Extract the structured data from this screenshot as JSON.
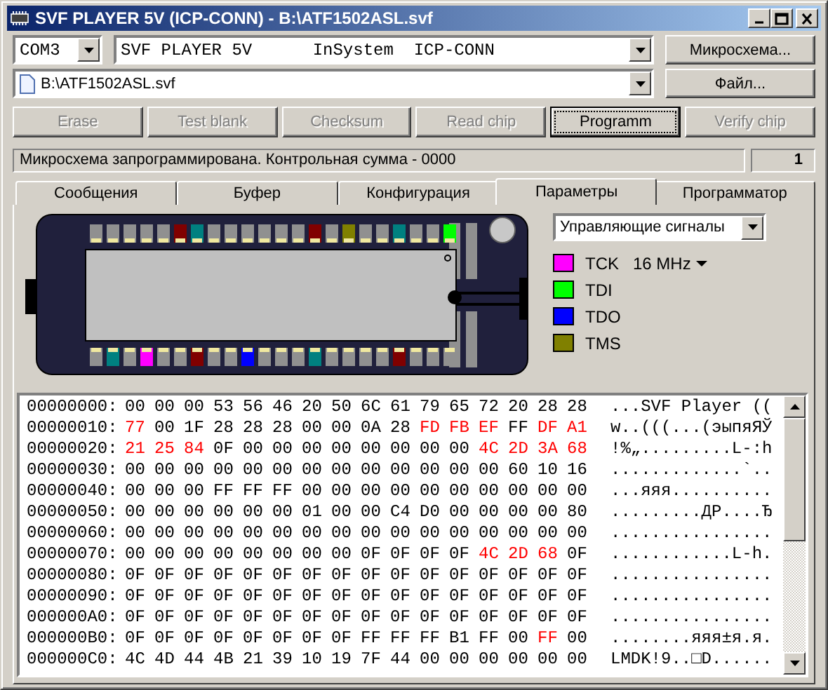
{
  "window": {
    "title": "SVF PLAYER 5V (ICP-CONN) - B:\\ATF1502ASL.svf"
  },
  "port_select": {
    "value": "COM3"
  },
  "device_select": {
    "value": "SVF PLAYER 5V      InSystem  ICP-CONN"
  },
  "chip_button": "Микросхема...",
  "file_select": {
    "value": "B:\\ATF1502ASL.svf"
  },
  "file_button": "Файл...",
  "actions": [
    {
      "label": "Erase",
      "disabled": true,
      "focused": false
    },
    {
      "label": "Test blank",
      "disabled": true,
      "focused": false
    },
    {
      "label": "Checksum",
      "disabled": true,
      "focused": false
    },
    {
      "label": "Read chip",
      "disabled": true,
      "focused": false
    },
    {
      "label": "Programm",
      "disabled": false,
      "focused": true
    },
    {
      "label": "Verify chip",
      "disabled": true,
      "focused": false
    }
  ],
  "status": {
    "message": "Микросхема запрограммирована. Контрольная сумма - 0000",
    "count": "1"
  },
  "tabs": [
    {
      "label": "Сообщения",
      "selected": false
    },
    {
      "label": "Буфер",
      "selected": false
    },
    {
      "label": "Конфигурация",
      "selected": false
    },
    {
      "label": "Параметры",
      "selected": true
    },
    {
      "label": "Программатор",
      "selected": false
    }
  ],
  "parameters": {
    "signal_select": {
      "value": "Управляющие сигналы"
    },
    "signals": [
      {
        "label": "TCK",
        "color": "#ff00ff",
        "frequency": "16 MHz"
      },
      {
        "label": "TDI",
        "color": "#00ff00"
      },
      {
        "label": "TDO",
        "color": "#0000ff"
      },
      {
        "label": "TMS",
        "color": "#808000"
      }
    ],
    "chip": {
      "top_pins": [
        {
          "color": "#909090"
        },
        {
          "color": "#909090"
        },
        {
          "color": "#909090"
        },
        {
          "color": "#909090"
        },
        {
          "color": "#909090"
        },
        {
          "color": "#800000"
        },
        {
          "color": "#008080"
        },
        {
          "color": "#909090"
        },
        {
          "color": "#909090"
        },
        {
          "color": "#909090"
        },
        {
          "color": "#909090"
        },
        {
          "color": "#909090"
        },
        {
          "color": "#909090"
        },
        {
          "color": "#800000"
        },
        {
          "color": "#909090"
        },
        {
          "color": "#808000"
        },
        {
          "color": "#909090"
        },
        {
          "color": "#909090"
        },
        {
          "color": "#008080"
        },
        {
          "color": "#909090"
        },
        {
          "color": "#909090"
        },
        {
          "color": "#00ff00"
        }
      ],
      "bottom_pins": [
        {
          "color": "#909090"
        },
        {
          "color": "#008080"
        },
        {
          "color": "#909090"
        },
        {
          "color": "#ff00ff"
        },
        {
          "color": "#909090"
        },
        {
          "color": "#909090"
        },
        {
          "color": "#800000"
        },
        {
          "color": "#909090"
        },
        {
          "color": "#909090"
        },
        {
          "color": "#0000ff"
        },
        {
          "color": "#909090"
        },
        {
          "color": "#909090"
        },
        {
          "color": "#909090"
        },
        {
          "color": "#008080"
        },
        {
          "color": "#909090"
        },
        {
          "color": "#909090"
        },
        {
          "color": "#909090"
        },
        {
          "color": "#909090"
        },
        {
          "color": "#800000"
        },
        {
          "color": "#909090"
        },
        {
          "color": "#909090"
        },
        {
          "color": "#909090"
        }
      ]
    }
  },
  "hex_dump": {
    "rows": [
      {
        "offset": "00000000:",
        "bytes": [
          {
            "value": "00",
            "changed": false
          },
          {
            "value": "00",
            "changed": false
          },
          {
            "value": "00",
            "changed": false
          },
          {
            "value": "53",
            "changed": false
          },
          {
            "value": "56",
            "changed": false
          },
          {
            "value": "46",
            "changed": false
          },
          {
            "value": "20",
            "changed": false
          },
          {
            "value": "50",
            "changed": false
          },
          {
            "value": "6C",
            "changed": false
          },
          {
            "value": "61",
            "changed": false
          },
          {
            "value": "79",
            "changed": false
          },
          {
            "value": "65",
            "changed": false
          },
          {
            "value": "72",
            "changed": false
          },
          {
            "value": "20",
            "changed": false
          },
          {
            "value": "28",
            "changed": false
          },
          {
            "value": "28",
            "changed": false
          }
        ],
        "ascii": "...SVF Player (("
      },
      {
        "offset": "00000010:",
        "bytes": [
          {
            "value": "77",
            "changed": true
          },
          {
            "value": "00",
            "changed": false
          },
          {
            "value": "1F",
            "changed": false
          },
          {
            "value": "28",
            "changed": false
          },
          {
            "value": "28",
            "changed": false
          },
          {
            "value": "28",
            "changed": false
          },
          {
            "value": "00",
            "changed": false
          },
          {
            "value": "00",
            "changed": false
          },
          {
            "value": "0A",
            "changed": false
          },
          {
            "value": "28",
            "changed": false
          },
          {
            "value": "FD",
            "changed": true
          },
          {
            "value": "FB",
            "changed": true
          },
          {
            "value": "EF",
            "changed": true
          },
          {
            "value": "FF",
            "changed": false
          },
          {
            "value": "DF",
            "changed": true
          },
          {
            "value": "A1",
            "changed": true
          }
        ],
        "ascii": "w..(((...(эыпяЯЎ"
      },
      {
        "offset": "00000020:",
        "bytes": [
          {
            "value": "21",
            "changed": true
          },
          {
            "value": "25",
            "changed": true
          },
          {
            "value": "84",
            "changed": true
          },
          {
            "value": "0F",
            "changed": false
          },
          {
            "value": "00",
            "changed": false
          },
          {
            "value": "00",
            "changed": false
          },
          {
            "value": "00",
            "changed": false
          },
          {
            "value": "00",
            "changed": false
          },
          {
            "value": "00",
            "changed": false
          },
          {
            "value": "00",
            "changed": false
          },
          {
            "value": "00",
            "changed": false
          },
          {
            "value": "00",
            "changed": false
          },
          {
            "value": "4C",
            "changed": true
          },
          {
            "value": "2D",
            "changed": true
          },
          {
            "value": "3A",
            "changed": true
          },
          {
            "value": "68",
            "changed": true
          }
        ],
        "ascii": "!%„.........L-:h"
      },
      {
        "offset": "00000030:",
        "bytes": [
          {
            "value": "00",
            "changed": false
          },
          {
            "value": "00",
            "changed": false
          },
          {
            "value": "00",
            "changed": false
          },
          {
            "value": "00",
            "changed": false
          },
          {
            "value": "00",
            "changed": false
          },
          {
            "value": "00",
            "changed": false
          },
          {
            "value": "00",
            "changed": false
          },
          {
            "value": "00",
            "changed": false
          },
          {
            "value": "00",
            "changed": false
          },
          {
            "value": "00",
            "changed": false
          },
          {
            "value": "00",
            "changed": false
          },
          {
            "value": "00",
            "changed": false
          },
          {
            "value": "00",
            "changed": false
          },
          {
            "value": "60",
            "changed": false
          },
          {
            "value": "10",
            "changed": false
          },
          {
            "value": "16",
            "changed": false
          }
        ],
        "ascii": ".............`.."
      },
      {
        "offset": "00000040:",
        "bytes": [
          {
            "value": "00",
            "changed": false
          },
          {
            "value": "00",
            "changed": false
          },
          {
            "value": "00",
            "changed": false
          },
          {
            "value": "FF",
            "changed": false
          },
          {
            "value": "FF",
            "changed": false
          },
          {
            "value": "FF",
            "changed": false
          },
          {
            "value": "00",
            "changed": false
          },
          {
            "value": "00",
            "changed": false
          },
          {
            "value": "00",
            "changed": false
          },
          {
            "value": "00",
            "changed": false
          },
          {
            "value": "00",
            "changed": false
          },
          {
            "value": "00",
            "changed": false
          },
          {
            "value": "00",
            "changed": false
          },
          {
            "value": "00",
            "changed": false
          },
          {
            "value": "00",
            "changed": false
          },
          {
            "value": "00",
            "changed": false
          }
        ],
        "ascii": "...яяя.........."
      },
      {
        "offset": "00000050:",
        "bytes": [
          {
            "value": "00",
            "changed": false
          },
          {
            "value": "00",
            "changed": false
          },
          {
            "value": "00",
            "changed": false
          },
          {
            "value": "00",
            "changed": false
          },
          {
            "value": "00",
            "changed": false
          },
          {
            "value": "00",
            "changed": false
          },
          {
            "value": "01",
            "changed": false
          },
          {
            "value": "00",
            "changed": false
          },
          {
            "value": "00",
            "changed": false
          },
          {
            "value": "C4",
            "changed": false
          },
          {
            "value": "D0",
            "changed": false
          },
          {
            "value": "00",
            "changed": false
          },
          {
            "value": "00",
            "changed": false
          },
          {
            "value": "00",
            "changed": false
          },
          {
            "value": "00",
            "changed": false
          },
          {
            "value": "80",
            "changed": false
          }
        ],
        "ascii": ".........ДР....Ђ"
      },
      {
        "offset": "00000060:",
        "bytes": [
          {
            "value": "00",
            "changed": false
          },
          {
            "value": "00",
            "changed": false
          },
          {
            "value": "00",
            "changed": false
          },
          {
            "value": "00",
            "changed": false
          },
          {
            "value": "00",
            "changed": false
          },
          {
            "value": "00",
            "changed": false
          },
          {
            "value": "00",
            "changed": false
          },
          {
            "value": "00",
            "changed": false
          },
          {
            "value": "00",
            "changed": false
          },
          {
            "value": "00",
            "changed": false
          },
          {
            "value": "00",
            "changed": false
          },
          {
            "value": "00",
            "changed": false
          },
          {
            "value": "00",
            "changed": false
          },
          {
            "value": "00",
            "changed": false
          },
          {
            "value": "00",
            "changed": false
          },
          {
            "value": "00",
            "changed": false
          }
        ],
        "ascii": "................"
      },
      {
        "offset": "00000070:",
        "bytes": [
          {
            "value": "00",
            "changed": false
          },
          {
            "value": "00",
            "changed": false
          },
          {
            "value": "00",
            "changed": false
          },
          {
            "value": "00",
            "changed": false
          },
          {
            "value": "00",
            "changed": false
          },
          {
            "value": "00",
            "changed": false
          },
          {
            "value": "00",
            "changed": false
          },
          {
            "value": "00",
            "changed": false
          },
          {
            "value": "0F",
            "changed": false
          },
          {
            "value": "0F",
            "changed": false
          },
          {
            "value": "0F",
            "changed": false
          },
          {
            "value": "0F",
            "changed": false
          },
          {
            "value": "4C",
            "changed": true
          },
          {
            "value": "2D",
            "changed": true
          },
          {
            "value": "68",
            "changed": true
          },
          {
            "value": "0F",
            "changed": false
          }
        ],
        "ascii": "............L-h."
      },
      {
        "offset": "00000080:",
        "bytes": [
          {
            "value": "0F",
            "changed": false
          },
          {
            "value": "0F",
            "changed": false
          },
          {
            "value": "0F",
            "changed": false
          },
          {
            "value": "0F",
            "changed": false
          },
          {
            "value": "0F",
            "changed": false
          },
          {
            "value": "0F",
            "changed": false
          },
          {
            "value": "0F",
            "changed": false
          },
          {
            "value": "0F",
            "changed": false
          },
          {
            "value": "0F",
            "changed": false
          },
          {
            "value": "0F",
            "changed": false
          },
          {
            "value": "0F",
            "changed": false
          },
          {
            "value": "0F",
            "changed": false
          },
          {
            "value": "0F",
            "changed": false
          },
          {
            "value": "0F",
            "changed": false
          },
          {
            "value": "0F",
            "changed": false
          },
          {
            "value": "0F",
            "changed": false
          }
        ],
        "ascii": "................"
      },
      {
        "offset": "00000090:",
        "bytes": [
          {
            "value": "0F",
            "changed": false
          },
          {
            "value": "0F",
            "changed": false
          },
          {
            "value": "0F",
            "changed": false
          },
          {
            "value": "0F",
            "changed": false
          },
          {
            "value": "0F",
            "changed": false
          },
          {
            "value": "0F",
            "changed": false
          },
          {
            "value": "0F",
            "changed": false
          },
          {
            "value": "0F",
            "changed": false
          },
          {
            "value": "0F",
            "changed": false
          },
          {
            "value": "0F",
            "changed": false
          },
          {
            "value": "0F",
            "changed": false
          },
          {
            "value": "0F",
            "changed": false
          },
          {
            "value": "0F",
            "changed": false
          },
          {
            "value": "0F",
            "changed": false
          },
          {
            "value": "0F",
            "changed": false
          },
          {
            "value": "0F",
            "changed": false
          }
        ],
        "ascii": "................"
      },
      {
        "offset": "000000A0:",
        "bytes": [
          {
            "value": "0F",
            "changed": false
          },
          {
            "value": "0F",
            "changed": false
          },
          {
            "value": "0F",
            "changed": false
          },
          {
            "value": "0F",
            "changed": false
          },
          {
            "value": "0F",
            "changed": false
          },
          {
            "value": "0F",
            "changed": false
          },
          {
            "value": "0F",
            "changed": false
          },
          {
            "value": "0F",
            "changed": false
          },
          {
            "value": "0F",
            "changed": false
          },
          {
            "value": "0F",
            "changed": false
          },
          {
            "value": "0F",
            "changed": false
          },
          {
            "value": "0F",
            "changed": false
          },
          {
            "value": "0F",
            "changed": false
          },
          {
            "value": "0F",
            "changed": false
          },
          {
            "value": "0F",
            "changed": false
          },
          {
            "value": "0F",
            "changed": false
          }
        ],
        "ascii": "................"
      },
      {
        "offset": "000000B0:",
        "bytes": [
          {
            "value": "0F",
            "changed": false
          },
          {
            "value": "0F",
            "changed": false
          },
          {
            "value": "0F",
            "changed": false
          },
          {
            "value": "0F",
            "changed": false
          },
          {
            "value": "0F",
            "changed": false
          },
          {
            "value": "0F",
            "changed": false
          },
          {
            "value": "0F",
            "changed": false
          },
          {
            "value": "0F",
            "changed": false
          },
          {
            "value": "FF",
            "changed": false
          },
          {
            "value": "FF",
            "changed": false
          },
          {
            "value": "FF",
            "changed": false
          },
          {
            "value": "B1",
            "changed": false
          },
          {
            "value": "FF",
            "changed": false
          },
          {
            "value": "00",
            "changed": false
          },
          {
            "value": "FF",
            "changed": true
          },
          {
            "value": "00",
            "changed": false
          }
        ],
        "ascii": "........яяя±я.я."
      },
      {
        "offset": "000000C0:",
        "bytes": [
          {
            "value": "4C",
            "changed": false
          },
          {
            "value": "4D",
            "changed": false
          },
          {
            "value": "44",
            "changed": false
          },
          {
            "value": "4B",
            "changed": false
          },
          {
            "value": "21",
            "changed": false
          },
          {
            "value": "39",
            "changed": false
          },
          {
            "value": "10",
            "changed": false
          },
          {
            "value": "19",
            "changed": false
          },
          {
            "value": "7F",
            "changed": false
          },
          {
            "value": "44",
            "changed": false
          },
          {
            "value": "00",
            "changed": false
          },
          {
            "value": "00",
            "changed": false
          },
          {
            "value": "00",
            "changed": false
          },
          {
            "value": "00",
            "changed": false
          },
          {
            "value": "00",
            "changed": false
          },
          {
            "value": "00",
            "changed": false
          }
        ],
        "ascii": "LMDK!9..□D......"
      }
    ]
  }
}
